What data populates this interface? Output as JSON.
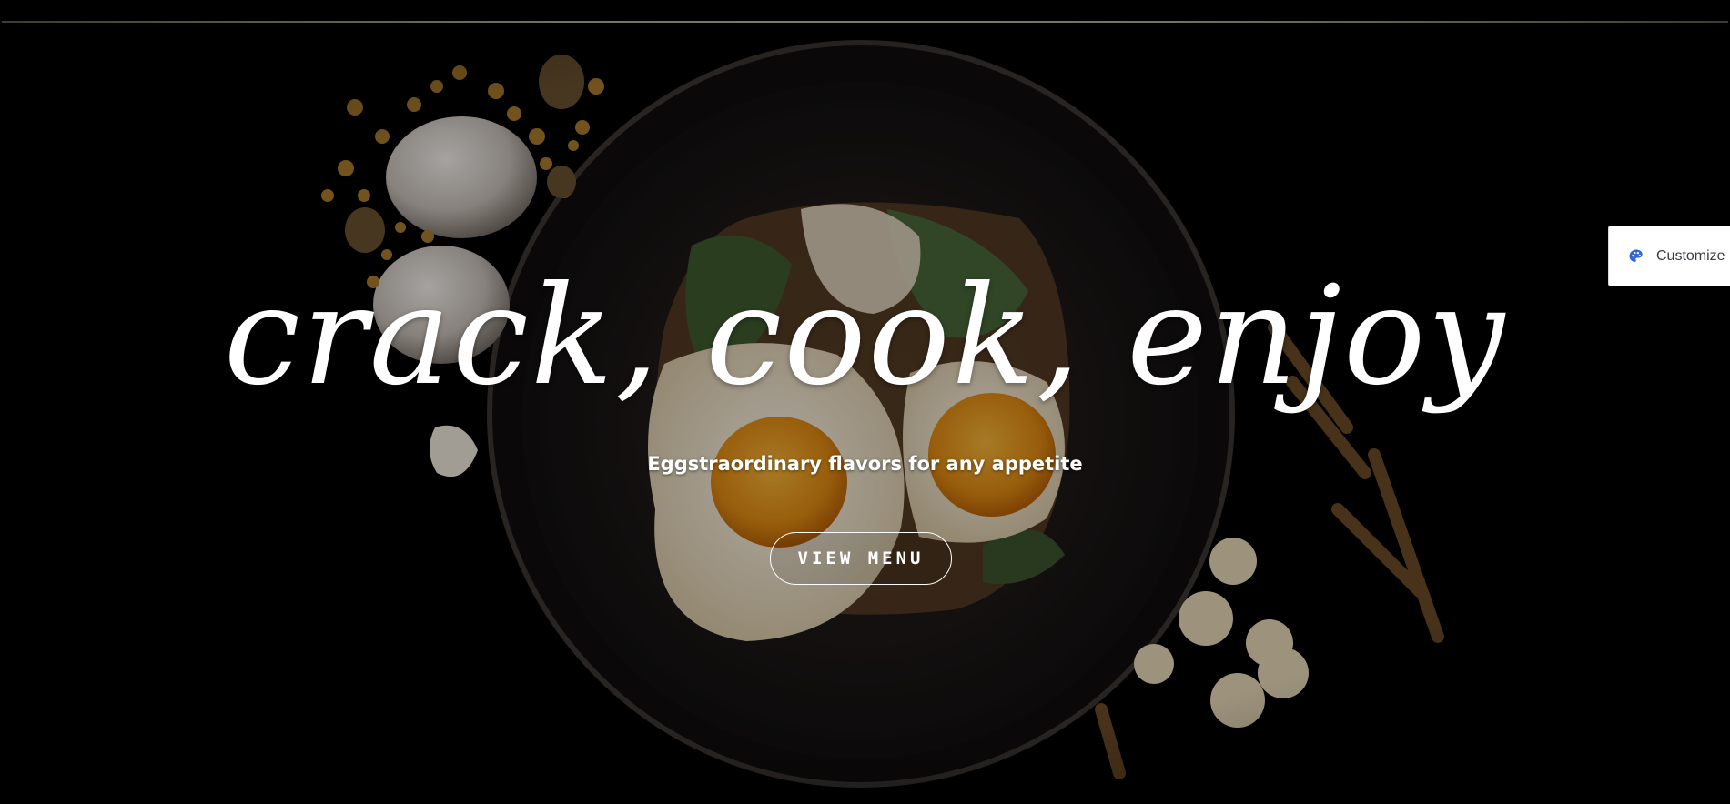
{
  "hero": {
    "title": "crack, cook, enjoy",
    "subtitle": "Eggstraordinary flavors for any appetite",
    "cta_label": "VIEW MENU"
  },
  "customize": {
    "label": "Customize",
    "icon": "palette-icon"
  },
  "colors": {
    "background": "#000000",
    "top_rule": "#d9c3b4",
    "accent_icon": "#2f63d6"
  }
}
